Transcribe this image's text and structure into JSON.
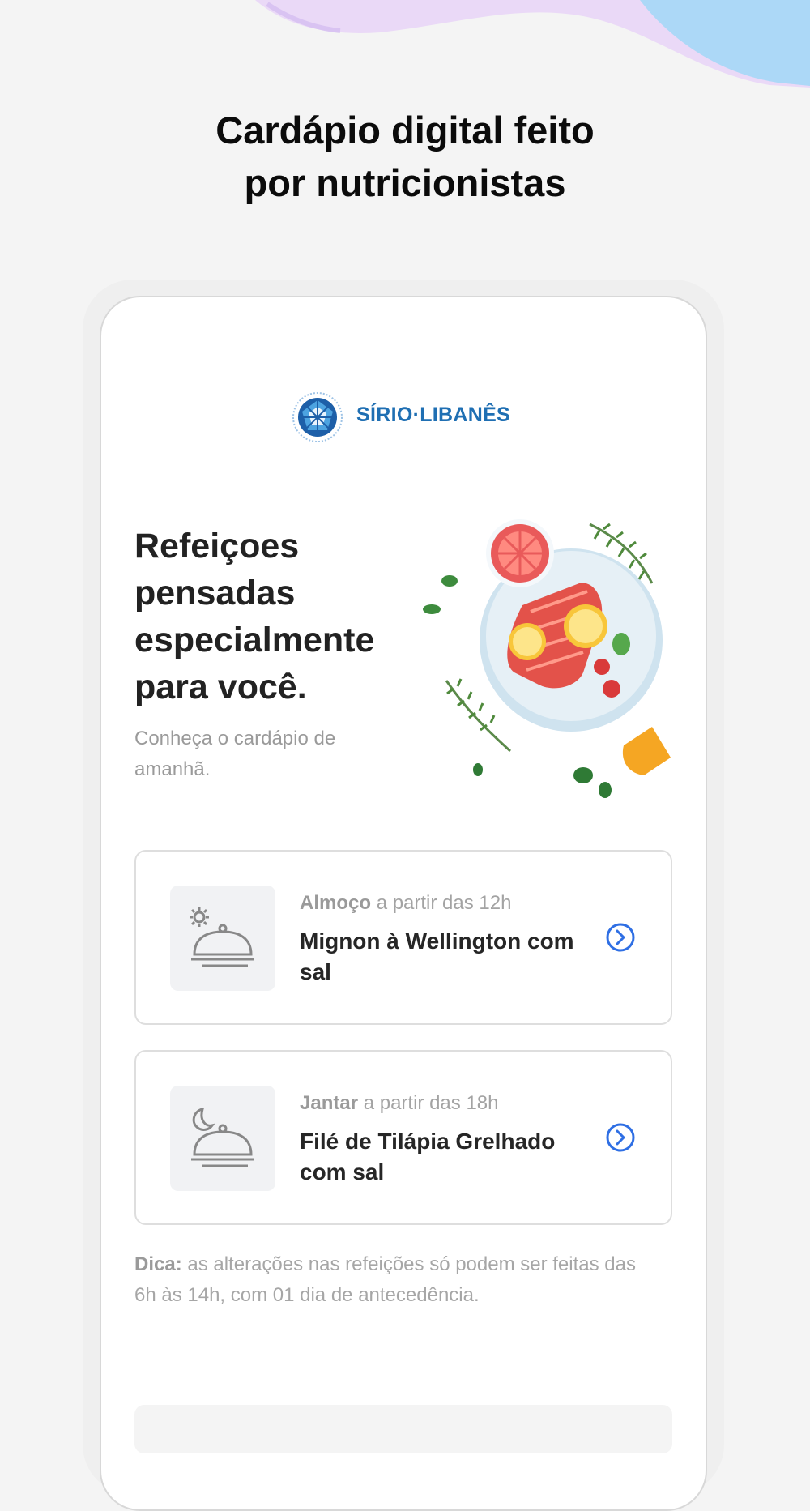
{
  "promo": {
    "title_line1": "Cardápio digital feito",
    "title_line2": "por nutricionistas"
  },
  "brand": {
    "logo_text": "SÍRIO·LIBANÊS"
  },
  "hero": {
    "heading": "Refeiçoes pensadas especialmente para você.",
    "subtext": "Conheça o cardápio de amanhã."
  },
  "meals": [
    {
      "meal": "Almoço",
      "time": "a partir das 12h",
      "dish": "Mignon à Wellington com sal",
      "icon": "sun-cloche-icon"
    },
    {
      "meal": "Jantar",
      "time": "a partir das 18h",
      "dish": "Filé de Tilápia Grelhado com sal",
      "icon": "moon-cloche-icon"
    }
  ],
  "tip": {
    "label": "Dica:",
    "text": "as alterações nas refeições só podem ser feitas das 6h às 14h, com 01 dia de antecedência."
  },
  "colors": {
    "accent": "#2f6fe4",
    "brand_blue": "#1f6fb3",
    "background": "#f4f4f4"
  }
}
